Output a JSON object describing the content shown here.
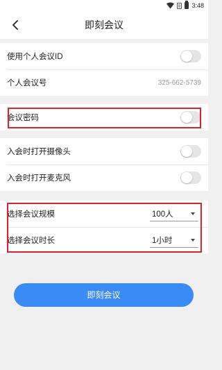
{
  "status_bar": {
    "time": "3:48"
  },
  "header": {
    "title": "即刻会议"
  },
  "section1": {
    "personal_id_label": "使用个人会议ID",
    "personal_id_toggle": "off",
    "meeting_number_label": "个人会议号",
    "meeting_number_value": "325-662-5739"
  },
  "section2": {
    "password_label": "会议密码",
    "password_toggle": "off"
  },
  "section3": {
    "camera_label": "入会时打开摄像头",
    "camera_toggle": "off",
    "mic_label": "入会时打开麦克风",
    "mic_toggle": "off"
  },
  "section4": {
    "scale_label": "选择会议规模",
    "scale_value": "100人",
    "duration_label": "选择会议时长",
    "duration_value": "1小时"
  },
  "primary_button": {
    "label": "即刻会议"
  },
  "colors": {
    "accent": "#3a8bf5",
    "highlight": "#e0202c",
    "toggle_off": "#e5e5e5"
  }
}
